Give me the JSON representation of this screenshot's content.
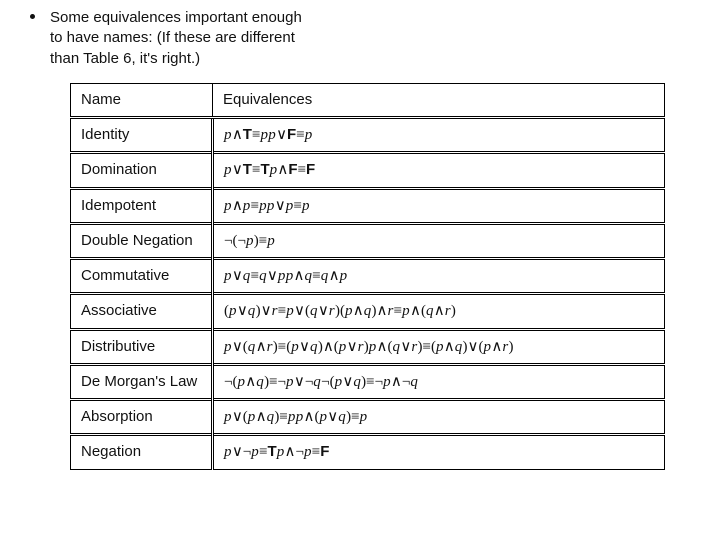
{
  "bullet": {
    "line1": "Some equivalences important enough",
    "line2": "to have names: (If these are different",
    "line3": "than Table 6, it's right.)"
  },
  "thead": {
    "c0": "Name",
    "c1": "Equivalences"
  },
  "rows": [
    {
      "name": "Identity",
      "eq": "p∧T≡pp∨F≡p",
      "eq_plain": "p ∧ T ≡ p   p ∨ F ≡ p"
    },
    {
      "name": "Domination",
      "eq": "p∨T≡Tp∧F≡F",
      "eq_plain": "p ∨ T ≡ T   p ∧ F ≡ F"
    },
    {
      "name": "Idempotent",
      "eq": "p∧p≡pp∨p≡p",
      "eq_plain": "p ∧ p ≡ p   p ∨ p ≡ p"
    },
    {
      "name": "Double Negation",
      "eq": "¬(¬p)≡p",
      "eq_plain": "¬(¬p) ≡ p"
    },
    {
      "name": "Commutative",
      "eq": "p∨q≡q∨pp∧q≡q∧p",
      "eq_plain": "p ∨ q ≡ q ∨ p   p ∧ q ≡ q ∧ p"
    },
    {
      "name": "Associative",
      "eq": "(p∨q)∨r≡p∨(q∨r)(p∧q)∧r≡p∧(q∧r)",
      "eq_plain": "(p ∨ q) ∨ r ≡ p ∨ (q ∨ r)   (p ∧ q) ∧ r ≡ p ∧ (q ∧ r)"
    },
    {
      "name": "Distributive",
      "eq": "p∨(q∧r)≡(p∨q)∧(p∨r)p∧(q∨r)≡(p∧q)∨(p∧r)",
      "eq_plain": "p ∨ (q ∧ r) ≡ (p ∨ q) ∧ (p ∨ r)   p ∧ (q ∨ r) ≡ (p ∧ q) ∨ (p ∧ r)"
    },
    {
      "name": "De Morgan's Law",
      "eq": "¬(p∧q)≡¬p∨¬q¬(p∨q)≡¬p∧¬q",
      "eq_plain": "¬(p ∧ q) ≡ ¬p ∨ ¬q   ¬(p ∨ q) ≡ ¬p ∧ ¬q"
    },
    {
      "name": "Absorption",
      "eq": "p∨(p∧q)≡pp∧(p∨q)≡p",
      "eq_plain": "p ∨ (p ∧ q) ≡ p   p ∧ (p ∨ q) ≡ p"
    },
    {
      "name": "Negation",
      "eq": "p∨¬p≡Tp∧¬p≡F",
      "eq_plain": "p ∨ ¬p ≡ T   p ∧ ¬p ≡ F"
    }
  ],
  "chart_data": {
    "type": "table",
    "title": "Logical Equivalences",
    "columns": [
      "Name",
      "Equivalences"
    ],
    "rows": [
      [
        "Identity",
        "p ∧ T ≡ p ; p ∨ F ≡ p"
      ],
      [
        "Domination",
        "p ∨ T ≡ T ; p ∧ F ≡ F"
      ],
      [
        "Idempotent",
        "p ∧ p ≡ p ; p ∨ p ≡ p"
      ],
      [
        "Double Negation",
        "¬(¬p) ≡ p"
      ],
      [
        "Commutative",
        "p ∨ q ≡ q ∨ p ; p ∧ q ≡ q ∧ p"
      ],
      [
        "Associative",
        "(p ∨ q) ∨ r ≡ p ∨ (q ∨ r) ; (p ∧ q) ∧ r ≡ p ∧ (q ∧ r)"
      ],
      [
        "Distributive",
        "p ∨ (q ∧ r) ≡ (p ∨ q) ∧ (p ∨ r) ; p ∧ (q ∨ r) ≡ (p ∧ q) ∨ (p ∧ r)"
      ],
      [
        "De Morgan's Law",
        "¬(p ∧ q) ≡ ¬p ∨ ¬q ; ¬(p ∨ q) ≡ ¬p ∧ ¬q"
      ],
      [
        "Absorption",
        "p ∨ (p ∧ q) ≡ p ; p ∧ (p ∨ q) ≡ p"
      ],
      [
        "Negation",
        "p ∨ ¬p ≡ T ; p ∧ ¬p ≡ F"
      ]
    ]
  }
}
